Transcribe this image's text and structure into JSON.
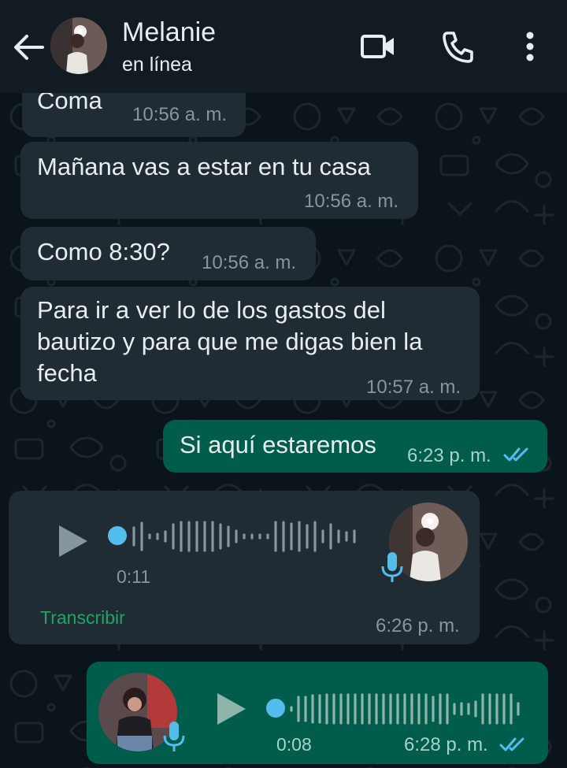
{
  "header": {
    "name": "Melanie",
    "status": "en línea"
  },
  "messages": {
    "m1": {
      "text": "Coma",
      "time": "10:56 a. m."
    },
    "m2": {
      "text": "Mañana vas a estar en tu casa",
      "time": "10:56 a. m."
    },
    "m3": {
      "text": "Como 8:30?",
      "time": "10:56 a. m."
    },
    "m4": {
      "line1": "Para ir a ver lo de los gastos del",
      "line2": "bautizo y para que me digas bien la",
      "line3": "fecha",
      "time": "10:57 a. m."
    },
    "m5": {
      "text": "Si aquí estaremos",
      "time": "6:23 p. m.",
      "status": "read"
    },
    "voice_in": {
      "duration": "0:11",
      "transcribe": "Transcribir",
      "time": "6:26 p. m.",
      "progress": 0.0
    },
    "voice_out": {
      "duration": "0:08",
      "time": "6:28 p. m.",
      "status": "read",
      "progress": 0.0
    }
  },
  "icons": {
    "back": "arrow-left-icon",
    "video": "video-camera-icon",
    "call": "phone-icon",
    "menu": "more-vert-icon",
    "play": "play-icon",
    "mic": "mic-icon",
    "read": "double-check-icon"
  },
  "colors": {
    "background": "#0b141a",
    "header": "#111b21",
    "incoming_bubble": "#202c33",
    "outgoing_bubble": "#005c4b",
    "read_ticks": "#53bdeb",
    "transcribe_link": "#21a366"
  }
}
